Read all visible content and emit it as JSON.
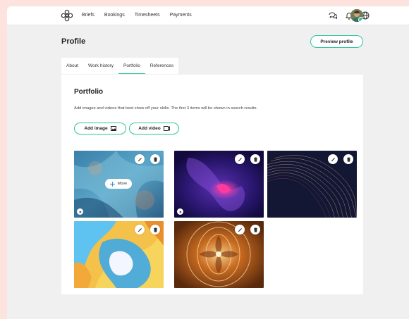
{
  "nav": {
    "items": [
      "Briefs",
      "Bookings",
      "Timesheets",
      "Payments"
    ]
  },
  "topbar_icons": [
    "chat-icon",
    "bell-icon",
    "globe-icon"
  ],
  "page": {
    "title": "Profile",
    "preview_button": "Preview profile"
  },
  "tabs": [
    {
      "label": "About",
      "active": false
    },
    {
      "label": "Work history",
      "active": false
    },
    {
      "label": "Portfolio",
      "active": true
    },
    {
      "label": "References",
      "active": false
    }
  ],
  "portfolio": {
    "title": "Portfolio",
    "description": "Add images and videos that best show off your skills. The first 3 items will be shown in search results.",
    "add_image": "Add image",
    "add_video": "Add video",
    "move_label": "Move"
  },
  "colors": {
    "accent": "#2cc59b",
    "background": "#f0f0f0",
    "outer": "#fde3de"
  }
}
